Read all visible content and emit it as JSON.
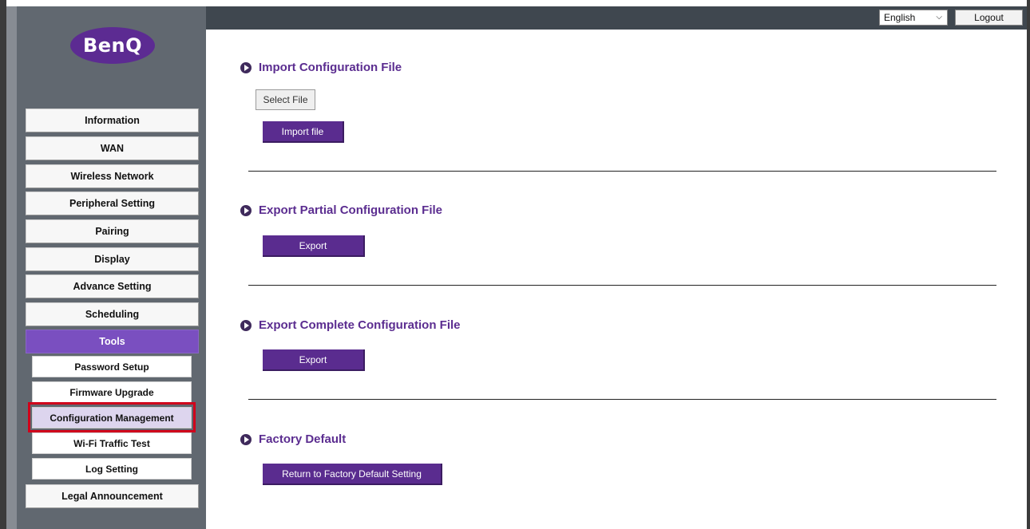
{
  "brand": {
    "logo_text": "BenQ",
    "accent_color": "#5a2c8f"
  },
  "header": {
    "language": "English",
    "logout_label": "Logout"
  },
  "sidebar": {
    "items": [
      {
        "label": "Information"
      },
      {
        "label": "WAN"
      },
      {
        "label": "Wireless Network"
      },
      {
        "label": "Peripheral Setting"
      },
      {
        "label": "Pairing"
      },
      {
        "label": "Display"
      },
      {
        "label": "Advance Setting"
      },
      {
        "label": "Scheduling"
      },
      {
        "label": "Tools"
      },
      {
        "label": "Legal Announcement"
      }
    ],
    "tools_subitems": [
      {
        "label": "Password Setup"
      },
      {
        "label": "Firmware Upgrade"
      },
      {
        "label": "Configuration Management"
      },
      {
        "label": "Wi-Fi Traffic Test"
      },
      {
        "label": "Log Setting"
      }
    ]
  },
  "main": {
    "import": {
      "title": "Import Configuration File",
      "select_label": "Select File",
      "import_label": "Import file"
    },
    "export_partial": {
      "title": "Export Partial Configuration File",
      "button_label": "Export"
    },
    "export_complete": {
      "title": "Export Complete Configuration File",
      "button_label": "Export"
    },
    "factory": {
      "title": "Factory Default",
      "button_label": "Return to Factory Default Setting"
    }
  }
}
